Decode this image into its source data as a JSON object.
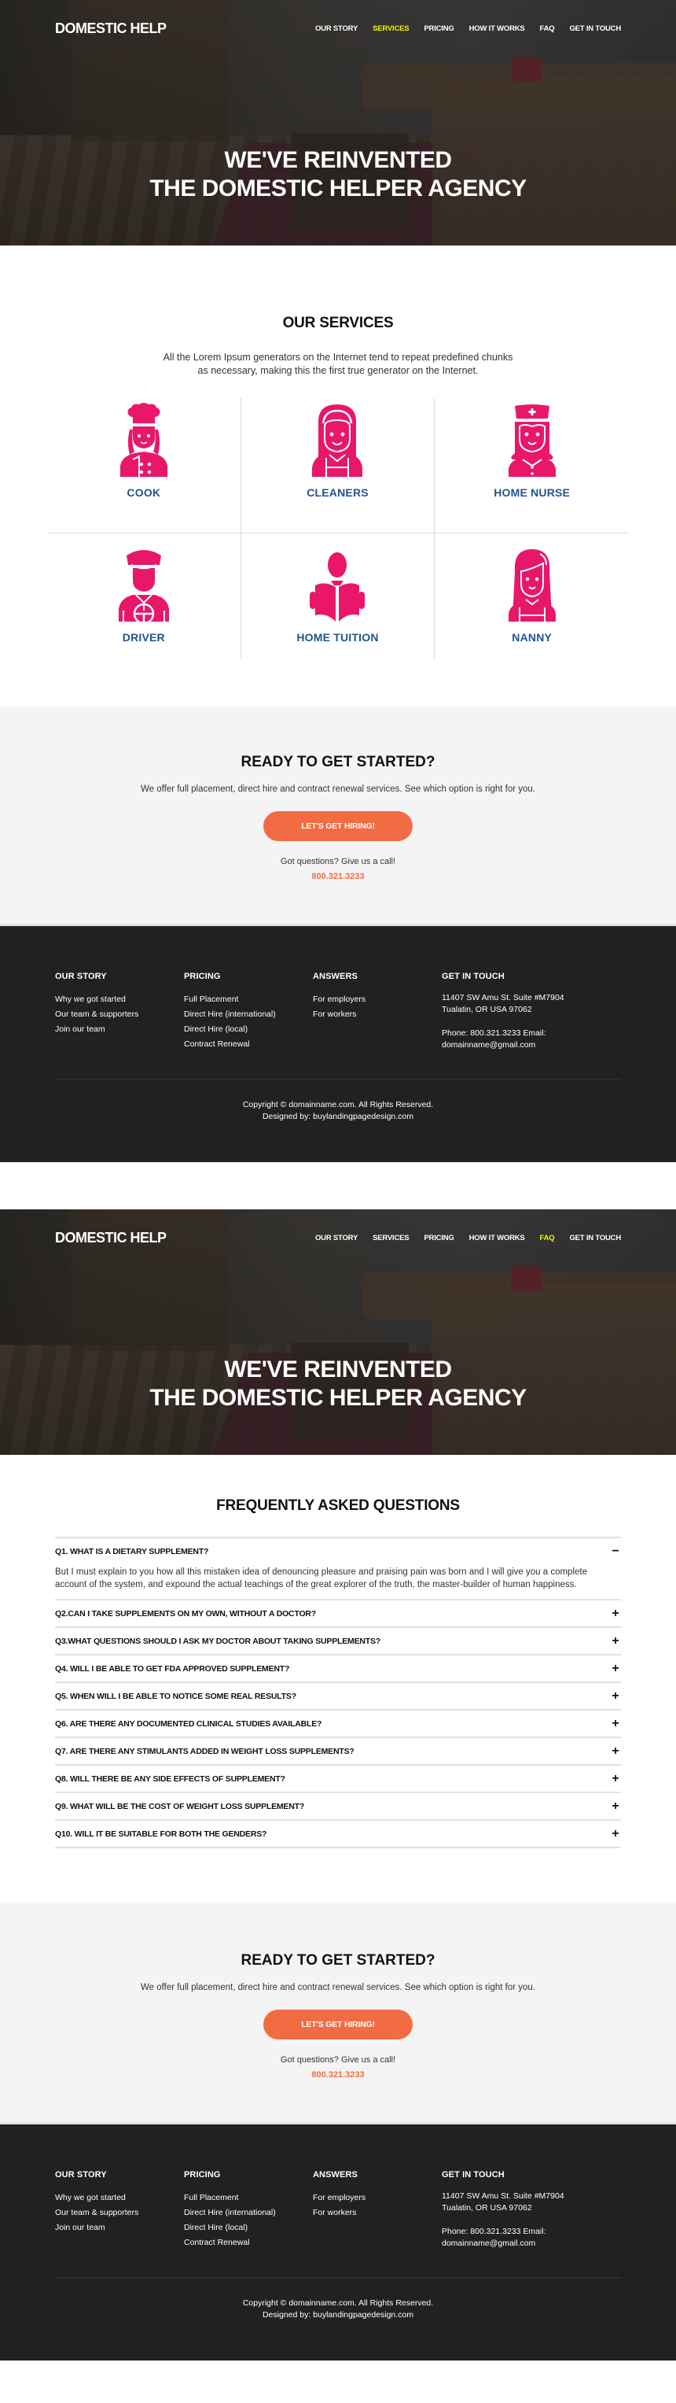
{
  "brand": "DOMESTIC HELP",
  "nav": [
    {
      "label": "OUR STORY"
    },
    {
      "label": "SERVICES"
    },
    {
      "label": "PRICING"
    },
    {
      "label": "HOW IT WORKS"
    },
    {
      "label": "FAQ"
    },
    {
      "label": "GET IN TOUCH"
    }
  ],
  "colors": {
    "nav_active": "#f4f400",
    "icon_pink": "#e8176a",
    "service_label_blue": "#21558e",
    "cta_orange": "#f26c43",
    "footer_bg": "#212121"
  },
  "page1": {
    "active_nav": "SERVICES",
    "hero": {
      "line1": "WE'VE REINVENTED",
      "line2": "THE DOMESTIC HELPER AGENCY"
    },
    "services": {
      "title": "OUR SERVICES",
      "intro": "All the Lorem Ipsum generators on the Internet tend to repeat predefined chunks as necessary, making this the first true generator on the Internet.",
      "items": [
        {
          "label": "COOK",
          "icon": "chef-icon"
        },
        {
          "label": "CLEANERS",
          "icon": "maid-icon"
        },
        {
          "label": "HOME NURSE",
          "icon": "nurse-icon"
        },
        {
          "label": "DRIVER",
          "icon": "chauffeur-icon"
        },
        {
          "label": "HOME TUITION",
          "icon": "reading-book-icon"
        },
        {
          "label": "NANNY",
          "icon": "nanny-icon"
        }
      ]
    }
  },
  "page2": {
    "active_nav": "FAQ",
    "hero": {
      "line1": "WE'VE REINVENTED",
      "line2": "THE DOMESTIC HELPER AGENCY"
    },
    "faq": {
      "title": "FREQUENTLY ASKED QUESTIONS",
      "items": [
        {
          "q": "Q1. WHAT IS A DIETARY SUPPLEMENT?",
          "expanded": true,
          "toggle": "−",
          "a": "But I must explain to you how all this mistaken idea of denouncing pleasure and praising pain was born and I will give you a complete account of the system, and expound the actual teachings of the great explorer of the truth, the master-builder of human happiness."
        },
        {
          "q": "Q2.CAN I TAKE SUPPLEMENTS ON MY OWN, WITHOUT A DOCTOR?",
          "expanded": false,
          "toggle": "+"
        },
        {
          "q": "Q3.WHAT QUESTIONS SHOULD I ASK MY DOCTOR ABOUT TAKING SUPPLEMENTS?",
          "expanded": false,
          "toggle": "+"
        },
        {
          "q": "Q4. WILL I BE ABLE TO GET FDA APPROVED SUPPLEMENT?",
          "expanded": false,
          "toggle": "+"
        },
        {
          "q": "Q5. WHEN WILL I BE ABLE TO NOTICE SOME REAL RESULTS?",
          "expanded": false,
          "toggle": "+"
        },
        {
          "q": "Q6. ARE THERE ANY DOCUMENTED CLINICAL STUDIES AVAILABLE?",
          "expanded": false,
          "toggle": "+"
        },
        {
          "q": "Q7. ARE THERE ANY STIMULANTS ADDED IN WEIGHT LOSS SUPPLEMENTS?",
          "expanded": false,
          "toggle": "+"
        },
        {
          "q": "Q8. WILL THERE BE ANY SIDE EFFECTS OF SUPPLEMENT?",
          "expanded": false,
          "toggle": "+"
        },
        {
          "q": "Q9. WHAT WILL BE THE COST OF WEIGHT LOSS SUPPLEMENT?",
          "expanded": false,
          "toggle": "+"
        },
        {
          "q": "Q10. WILL IT BE SUITABLE FOR BOTH THE GENDERS?",
          "expanded": false,
          "toggle": "+"
        }
      ]
    }
  },
  "cta": {
    "title": "READY TO GET STARTED?",
    "subtitle": "We offer full placement, direct hire and contract renewal services. See which option is right for you.",
    "button": "LET'S GET HIRING!",
    "question": "Got questions? Give us a call!",
    "phone": "800.321.3233"
  },
  "footer": {
    "columns": [
      {
        "title": "OUR STORY",
        "links": [
          "Why we got started",
          "Our team & supporters",
          "Join our team"
        ]
      },
      {
        "title": "PRICING",
        "links": [
          "Full Placement",
          "Direct Hire (international)",
          "Direct Hire (local)",
          "Contract Renewal"
        ]
      },
      {
        "title": "ANSWERS",
        "links": [
          "For employers",
          "For workers"
        ]
      }
    ],
    "contact": {
      "title": "GET IN TOUCH",
      "address1": "11407 SW Amu St. Suite #M7904",
      "address2": "Tualatin, OR USA 97062",
      "phone_email1": "Phone: 800.321.3233 Email:",
      "phone_email2": "domainname@gmail.com"
    },
    "copyright": "Copyright © domainname.com. All Rights Reserved.",
    "designed_by": "Designed by: buylandingpagedesign.com"
  }
}
